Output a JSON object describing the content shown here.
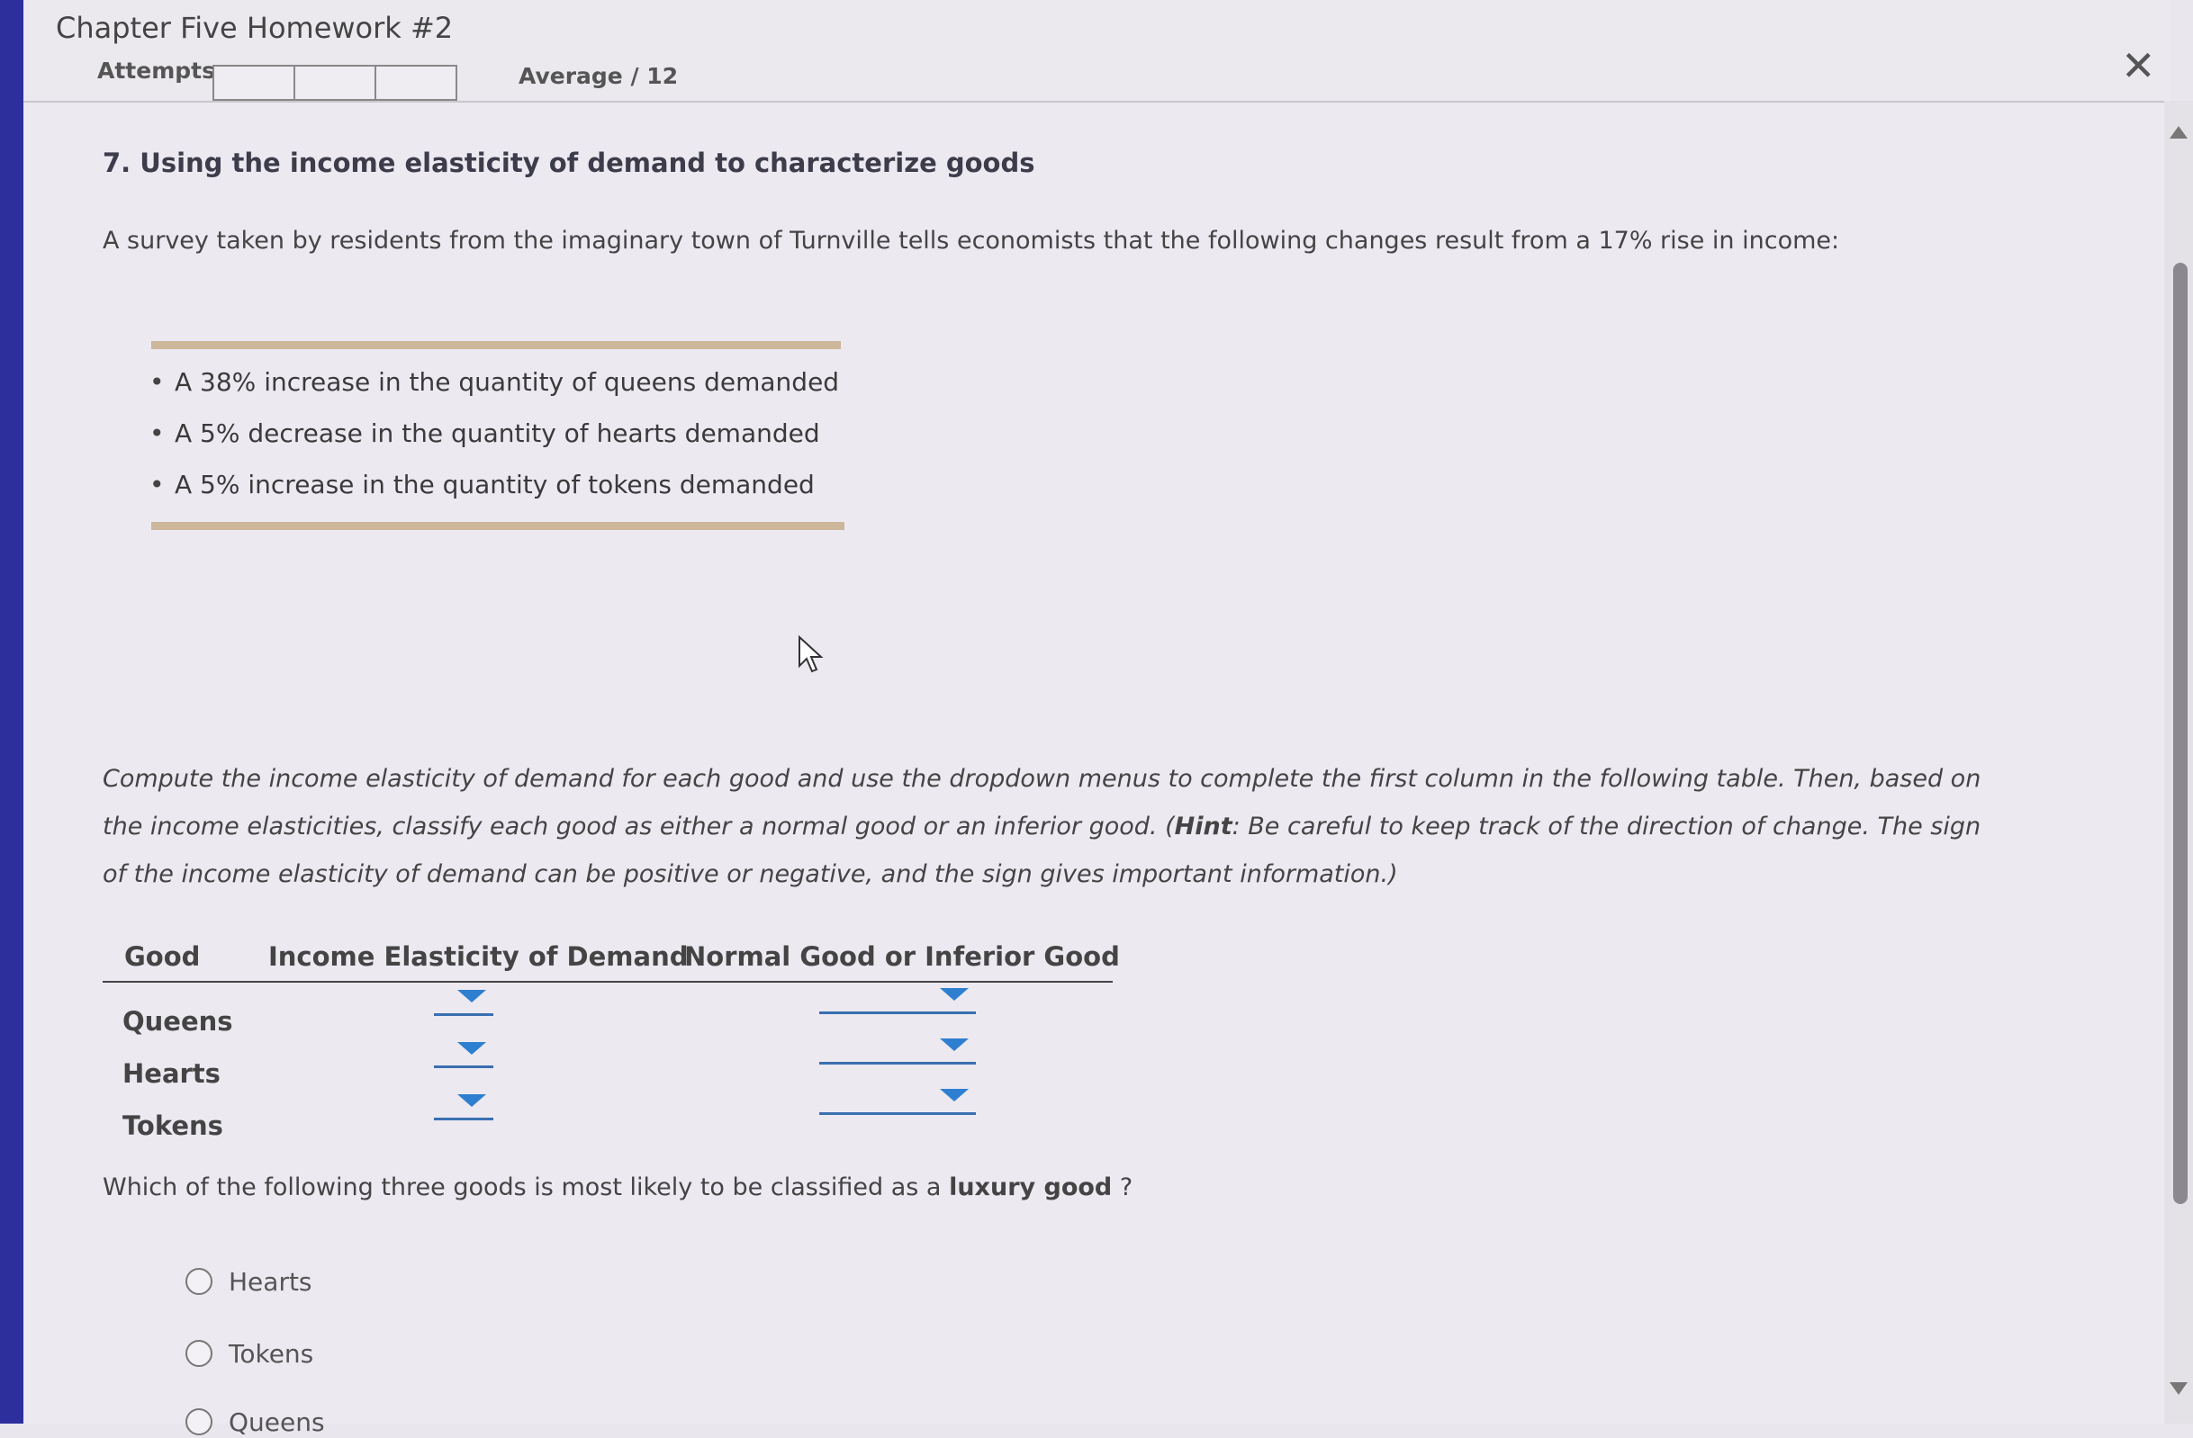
{
  "header": {
    "title": "Chapter Five Homework #2",
    "attempts_label": "Attempts",
    "average_label": "Average / 12",
    "close_icon": "close-icon"
  },
  "question": {
    "title": "7. Using the income elasticity of demand to characterize goods",
    "intro": "A survey taken by residents from the imaginary town of Turnville tells economists that the following changes result from a 17% rise in income:",
    "bullets": [
      "A 38% increase in the quantity of queens demanded",
      "A 5% decrease in the quantity of hearts demanded",
      "A 5% increase in the quantity of tokens demanded"
    ],
    "instructions_part1": "Compute the income elasticity of demand for each good and use the dropdown menus to complete the first column in the following table. Then, based on the income elasticities, classify each good as either a normal good or an inferior good. (",
    "instructions_hint": "Hint",
    "instructions_part2": ": Be careful to keep track of the direction of change. The sign of the income elasticity of demand can be positive or negative, and the sign gives important information.)"
  },
  "table": {
    "headers": [
      "Good",
      "Income Elasticity of Demand",
      "Normal Good or Inferior Good"
    ],
    "rows": [
      {
        "good": "Queens",
        "elasticity": "",
        "classification": ""
      },
      {
        "good": "Hearts",
        "elasticity": "",
        "classification": ""
      },
      {
        "good": "Tokens",
        "elasticity": "",
        "classification": ""
      }
    ]
  },
  "luxury_question": {
    "prefix": "Which of the following three goods is most likely to be classified as a",
    "bold": "luxury good",
    "suffix": "?",
    "options": [
      "Hearts",
      "Tokens",
      "Queens"
    ]
  },
  "colors": {
    "accent": "#2f7fd0",
    "rule": "#cdb79a",
    "left_strip": "#2c2f9c"
  }
}
